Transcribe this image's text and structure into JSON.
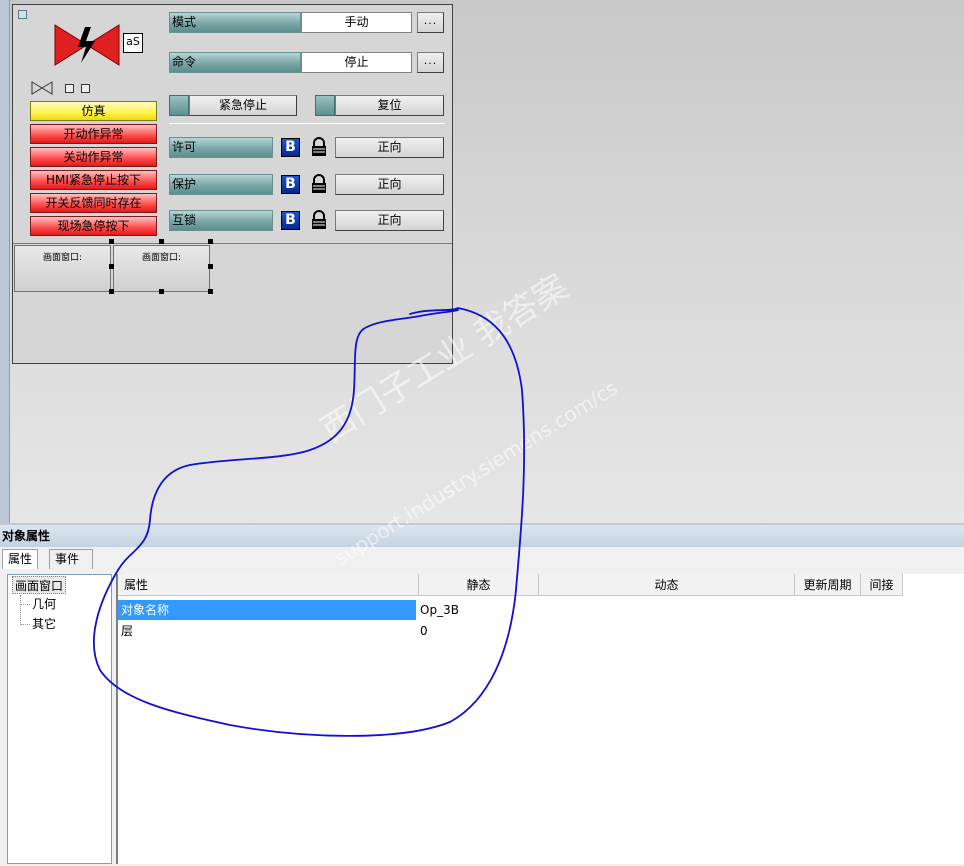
{
  "faceplate": {
    "tag_badge": "aS",
    "mode_label": "模式",
    "mode_value": "手动",
    "command_label": "命令",
    "command_value": "停止",
    "more_button": "...",
    "emergency_stop": "紧急停止",
    "reset": "复位",
    "interlocks": [
      {
        "label": "许可",
        "badge": "B",
        "button": "正向"
      },
      {
        "label": "保护",
        "badge": "B",
        "button": "正向"
      },
      {
        "label": "互锁",
        "badge": "B",
        "button": "正向"
      }
    ],
    "alarms": [
      {
        "label": "仿真",
        "color": "#fff350"
      },
      {
        "label": "开动作异常",
        "color": "#ff4a4a"
      },
      {
        "label": "关动作异常",
        "color": "#ff4a4a"
      },
      {
        "label": "HMI紧急停止按下",
        "color": "#ff4a4a"
      },
      {
        "label": "开关反馈同时存在",
        "color": "#ff4a4a"
      },
      {
        "label": "现场急停按下",
        "color": "#ff4a4a"
      }
    ],
    "sub_windows": [
      "画面窗口:",
      "画面窗口:"
    ]
  },
  "properties": {
    "title": "对象属性",
    "tabs": [
      "属性",
      "事件"
    ],
    "tree": {
      "root": "画面窗口",
      "children": [
        "几何",
        "其它"
      ]
    },
    "columns": [
      "属性",
      "静态",
      "动态",
      "更新周期",
      "间接"
    ],
    "rows": [
      {
        "name": "对象名称",
        "static": "Op_3B"
      },
      {
        "name": "层",
        "static": "0"
      }
    ]
  },
  "watermark": {
    "line1": "西门子工业 我答案",
    "line2": "support.industry.siemens.com/cs"
  },
  "colors": {
    "selection": "#3399ff",
    "annotation_stroke": "#1010d0",
    "valve": "#e02020"
  }
}
